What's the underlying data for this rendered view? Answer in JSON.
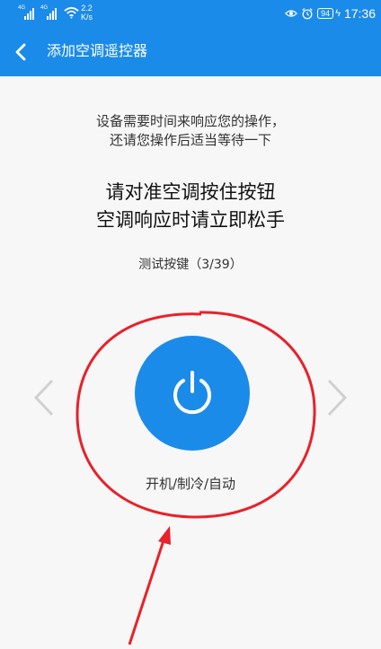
{
  "status_bar": {
    "sim1_label": "4G",
    "sim2_label": "4G",
    "net_speed_value": "2.2",
    "net_speed_unit": "K/s",
    "battery": "94",
    "time": "17:36"
  },
  "header": {
    "title": "添加空调遥控器"
  },
  "hint": {
    "line1": "设备需要时间来响应您的操作，",
    "line2": "还请您操作后适当等待一下"
  },
  "instruction": {
    "line1": "请对准空调按住按钮",
    "line2": "空调响应时请立即松手"
  },
  "test": {
    "counter": "测试按键（3/39）"
  },
  "power_button": {
    "label": "开机/制冷/自动"
  },
  "colors": {
    "brand": "#1b8bea",
    "annotation": "#e8212a"
  },
  "icons": [
    "back-icon",
    "power-icon",
    "chevron-left-icon",
    "chevron-right-icon",
    "wifi-icon",
    "eye-icon",
    "alarm-icon"
  ]
}
